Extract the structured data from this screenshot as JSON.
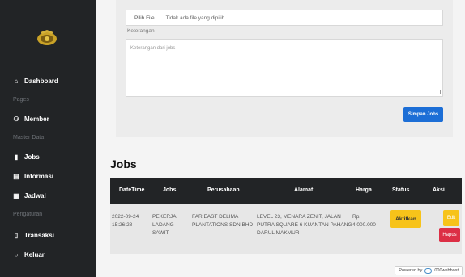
{
  "sidebar": {
    "logo": "police-crest-logo",
    "items": [
      {
        "label": "Dashboard",
        "icon": "home-icon"
      },
      {
        "heading": "Pages"
      },
      {
        "label": "Member",
        "icon": "users-icon"
      },
      {
        "heading": "Master Data"
      },
      {
        "label": "Jobs",
        "icon": "document-icon"
      },
      {
        "label": "Informasi",
        "icon": "list-icon"
      },
      {
        "label": "Jadwal",
        "icon": "table-icon"
      },
      {
        "heading": "Pengaturan"
      },
      {
        "label": "Transaksi",
        "icon": "file-icon"
      },
      {
        "label": "Keluar",
        "icon": "circle-icon"
      }
    ]
  },
  "form": {
    "file_button": "Pilih File",
    "file_status": "Tidak ada file yang dipilih",
    "keterangan_label": "Keterangan",
    "keterangan_placeholder": "Keterangan dari jobs",
    "submit_label": "Simpan Jobs"
  },
  "jobs": {
    "title": "Jobs",
    "columns": [
      "DateTime",
      "Jobs",
      "Perusahaan",
      "Alamat",
      "Harga",
      "Status",
      "Aksi"
    ],
    "rows": [
      {
        "datetime_date": "2022-09-24",
        "datetime_time": "15:26:28",
        "jobs_l1": "PEKERJA",
        "jobs_l2": "LADANG",
        "jobs_l3": "SAWIT",
        "perusahaan_l1": "FAR EAST DELIMA",
        "perusahaan_l2": "PLANTATIONS SDN BHD",
        "alamat_l1": "LEVEL 23, MENARA ZENIT, JALAN",
        "alamat_l2": "PUTRA SQUARE 6 KUANTAN PAHANG",
        "alamat_l3": "DARUL MAKMUR",
        "harga_l1": "Rp.",
        "harga_l2": "4.000.000",
        "status": "Aktifkan",
        "edit": "Edit",
        "hapus": "Hapus"
      }
    ]
  },
  "footer": {
    "powered_by": "Powered by",
    "host": "000webhost"
  },
  "colors": {
    "sidebar_bg": "#222426",
    "primary": "#1c6ed6",
    "warning": "#f7c31a",
    "danger": "#dc2f45"
  }
}
